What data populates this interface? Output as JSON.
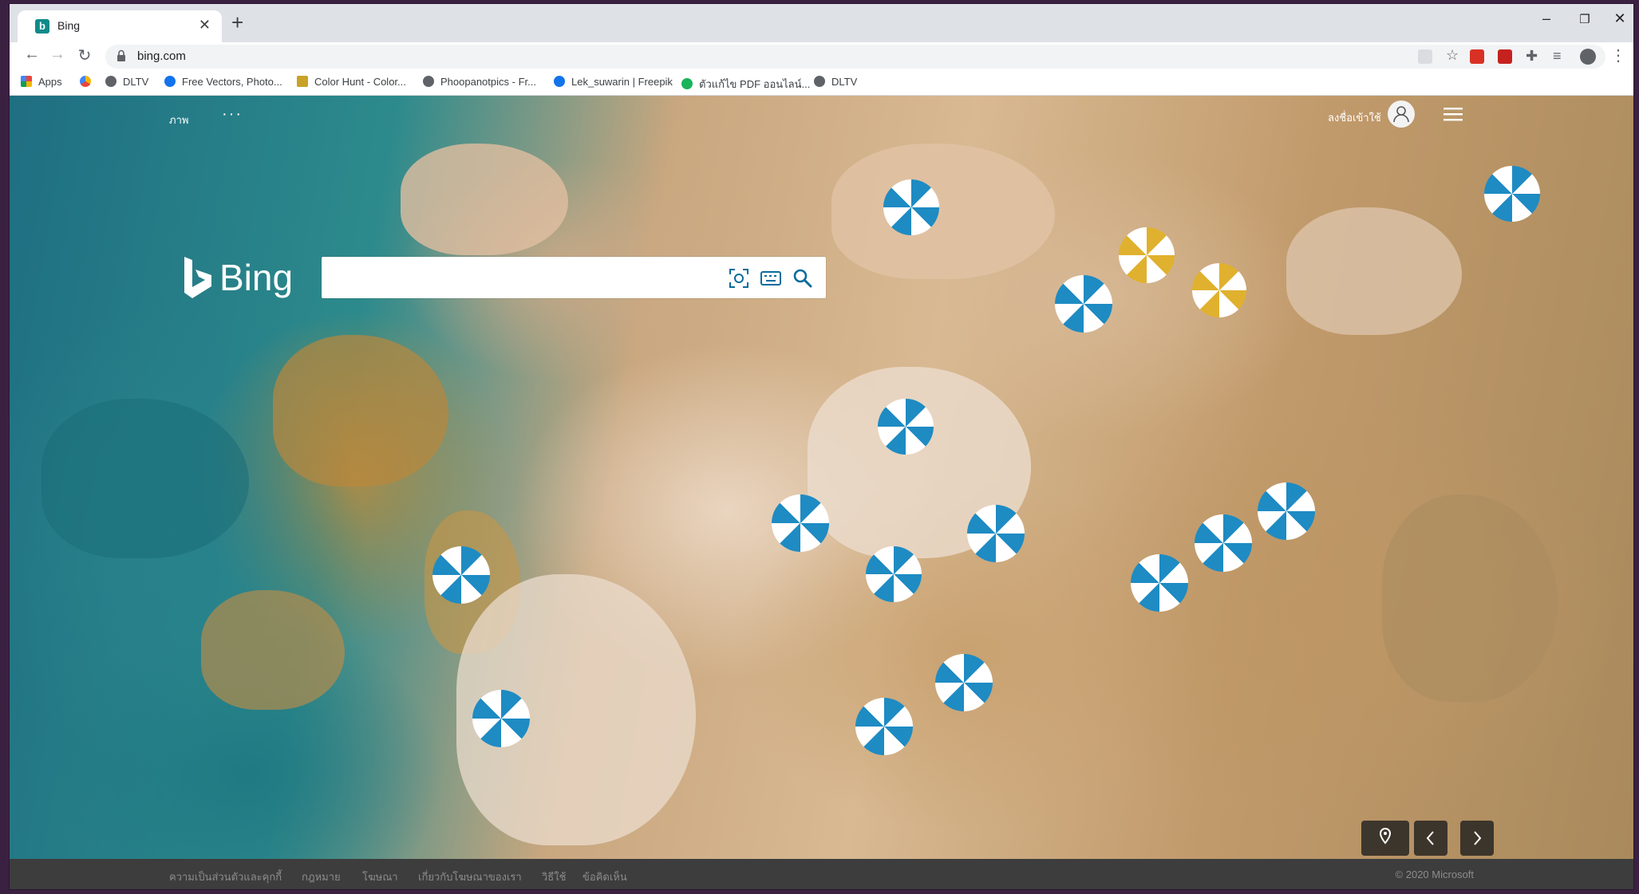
{
  "browser": {
    "tab_title": "Bing",
    "tab_favicon": "b",
    "url": "bing.com"
  },
  "bookmarks": [
    {
      "label": "Apps",
      "icon": "apps-grid-icon",
      "color": "#e8453c"
    },
    {
      "label": "",
      "icon": "colorful-bookmark-icon",
      "color": "#f4b400"
    },
    {
      "label": "DLTV",
      "icon": "globe-icon",
      "color": "#5f6368"
    },
    {
      "label": "Free Vectors, Photo...",
      "icon": "freepik-icon",
      "color": "#1273eb"
    },
    {
      "label": "Color Hunt - Color...",
      "icon": "colorhunt-icon",
      "color": "#c9a227"
    },
    {
      "label": "Phoopanotpics - Fr...",
      "icon": "globe-icon",
      "color": "#5f6368"
    },
    {
      "label": "Lek_suwarin | Freepik",
      "icon": "freepik-icon",
      "color": "#1273eb"
    },
    {
      "label": "ตัวแก้ไข PDF ออนไลน์...",
      "icon": "smallpdf-icon",
      "color": "#19b35a"
    },
    {
      "label": "DLTV",
      "icon": "globe-icon",
      "color": "#5f6368"
    }
  ],
  "bing": {
    "images_label": "ภาพ",
    "more_label": "···",
    "signin_label": "ลงชื่อเข้าใช้",
    "logo_text": "Bing",
    "search_value": ""
  },
  "footer": {
    "links": [
      "ความเป็นส่วนตัวและคุกกี้",
      "กฎหมาย",
      "โฆษณา",
      "เกี่ยวกับโฆษณาของเรา",
      "วิธีใช้",
      "ข้อคิดเห็น"
    ],
    "copyright": "© 2020 Microsoft"
  },
  "colors": {
    "bing_accent": "#ffffff",
    "footer_bg": "#3d3d3d",
    "umbrella_blue": "#1e8bc3",
    "umbrella_yellow": "#e0b12e"
  }
}
